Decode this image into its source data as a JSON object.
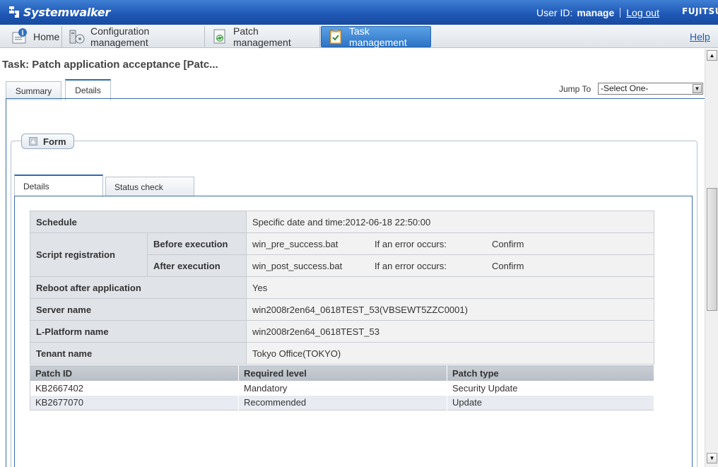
{
  "header": {
    "brand": "Systemwalker",
    "user_label": "User ID:",
    "user_name": "manage",
    "logout": "Log out",
    "vendor": "FUJITSU"
  },
  "nav": {
    "items": [
      {
        "label": "Home",
        "icon": "home-info-icon"
      },
      {
        "label": "Configuration management",
        "icon": "configuration-icon"
      },
      {
        "label": "Patch management",
        "icon": "patch-icon"
      },
      {
        "label": "Task management",
        "icon": "task-clipboard-icon"
      }
    ],
    "active": "Task management",
    "help": "Help"
  },
  "page": {
    "title": "Task: Patch application acceptance [Patc...",
    "tabs": [
      "Summary",
      "Details"
    ],
    "active_tab": "Details",
    "jump_to_label": "Jump To",
    "jump_to_value": "-Select One-"
  },
  "form": {
    "legend": "Form",
    "tabs": [
      "Details",
      "Status check"
    ],
    "active_tab": "Details",
    "details": {
      "schedule_label": "Schedule",
      "schedule_value": "Specific date and time:2012-06-18 22:50:00",
      "script_label": "Script registration",
      "before_label": "Before execution",
      "before_script": "win_pre_success.bat",
      "before_error_label": "If an error occurs:",
      "before_error_value": "Confirm",
      "after_label": "After execution",
      "after_script": "win_post_success.bat",
      "after_error_label": "If an error occurs:",
      "after_error_value": "Confirm",
      "reboot_label": "Reboot after application",
      "reboot_value": "Yes",
      "server_label": "Server name",
      "server_value": "win2008r2en64_0618TEST_53(VBSEWT5ZZC0001)",
      "lplatform_label": "L-Platform name",
      "lplatform_value": "win2008r2en64_0618TEST_53",
      "tenant_label": "Tenant name",
      "tenant_value": "Tokyo Office(TOKYO)"
    },
    "patches": {
      "headers": [
        "Patch ID",
        "Required level",
        "Patch type"
      ],
      "rows": [
        [
          "KB2667402",
          "Mandatory",
          "Security Update"
        ],
        [
          "KB2677070",
          "Recommended",
          "Update"
        ]
      ]
    }
  },
  "colors": {
    "header_blue": "#1d56b4",
    "active_nav": "#2d74c6",
    "tab_border": "#3a6ea8"
  }
}
